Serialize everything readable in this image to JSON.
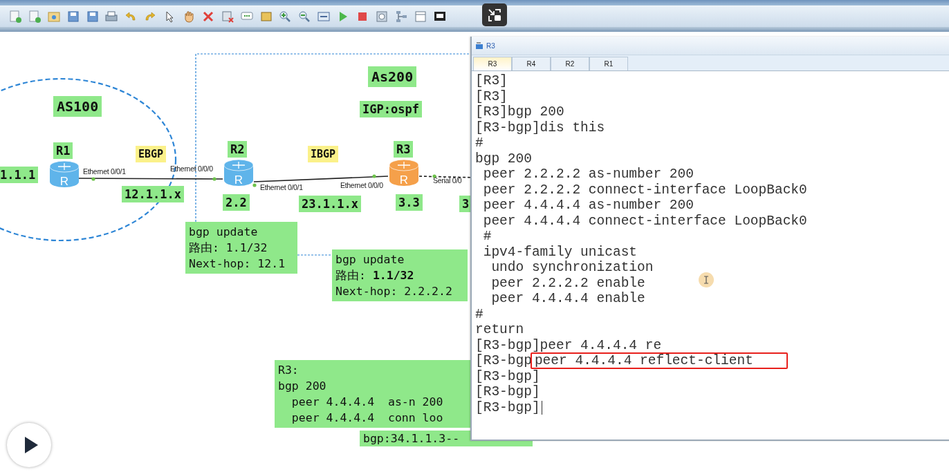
{
  "canvas": {
    "labels": [
      {
        "kind": "note",
        "text": "As200"
      },
      {
        "kind": "note",
        "text": "AS100"
      },
      {
        "kind": "note",
        "text": "IGP:ospf"
      },
      {
        "kind": "note",
        "text": "R1"
      },
      {
        "kind": "note",
        "text": "R2"
      },
      {
        "kind": "note",
        "text": "R3"
      },
      {
        "kind": "protocol",
        "text": "EBGP"
      },
      {
        "kind": "protocol",
        "text": "IBGP"
      },
      {
        "kind": "note",
        "text": "1.1.1"
      },
      {
        "kind": "note",
        "text": "12.1.1.x"
      },
      {
        "kind": "note",
        "text": "2.2"
      },
      {
        "kind": "note",
        "text": "23.1.1.x"
      },
      {
        "kind": "note",
        "text": "3.3"
      },
      {
        "kind": "note",
        "text": "3"
      },
      {
        "kind": "interface",
        "text": "Ethernet 0/0/1"
      },
      {
        "kind": "interface",
        "text": "Ethernet 0/0/0"
      },
      {
        "kind": "interface",
        "text": "Ethernet 0/0/1"
      },
      {
        "kind": "interface",
        "text": "Ethernet 0/0/0"
      },
      {
        "kind": "interface",
        "text": "Serial 0/0"
      }
    ],
    "routers": [
      {
        "letter": "R",
        "color": "#5fb4ea"
      },
      {
        "letter": "R",
        "color": "#5fb4ea"
      },
      {
        "letter": "R",
        "color": "#f5a04a"
      }
    ],
    "notes": [
      {
        "lines": [
          "bgp update",
          "路由: 1.1/32",
          "Next-hop: 12.1"
        ]
      },
      {
        "lines": [
          "bgp update",
          "路由: **1.1/32**",
          "Next-hop: 2.2.2.2"
        ]
      },
      {
        "lines": [
          "R3:",
          "bgp 200",
          "  peer 4.4.4.4  as-n 200",
          "  peer 4.4.4.4  conn loo"
        ]
      },
      {
        "lines": [
          "bgp:34.1.1.3--"
        ]
      }
    ]
  },
  "terminal": {
    "title": "R3",
    "tabs": [
      {
        "label": "R3",
        "selected": true
      },
      {
        "label": "R4",
        "selected": false
      },
      {
        "label": "R2",
        "selected": false
      },
      {
        "label": "R1",
        "selected": false
      }
    ],
    "lines": [
      {
        "text": "[R3]"
      },
      {
        "text": "[R3]"
      },
      {
        "text": "[R3]bgp 200"
      },
      {
        "text": "[R3-bgp]dis this"
      },
      {
        "text": "#"
      },
      {
        "text": "bgp 200"
      },
      {
        "text": " peer 2.2.2.2 as-number 200"
      },
      {
        "text": " peer 2.2.2.2 connect-interface LoopBack0"
      },
      {
        "text": " peer 4.4.4.4 as-number 200"
      },
      {
        "text": " peer 4.4.4.4 connect-interface LoopBack0"
      },
      {
        "text": " #"
      },
      {
        "text": " ipv4-family unicast"
      },
      {
        "text": "  undo synchronization"
      },
      {
        "text": "  peer 2.2.2.2 enable"
      },
      {
        "text": "  peer 4.4.4.4 enable"
      },
      {
        "text": "#"
      },
      {
        "text": "return"
      },
      {
        "text": "[R3-bgp]peer 4.4.4.4 re"
      },
      {
        "text": "[R3-bgp",
        "boxed": "peer 4.4.4.4 reflect-client"
      },
      {
        "text": "[R3-bgp]"
      },
      {
        "text": "[R3-bgp]"
      },
      {
        "text": "[R3-bgp]",
        "cursor": true
      }
    ]
  }
}
